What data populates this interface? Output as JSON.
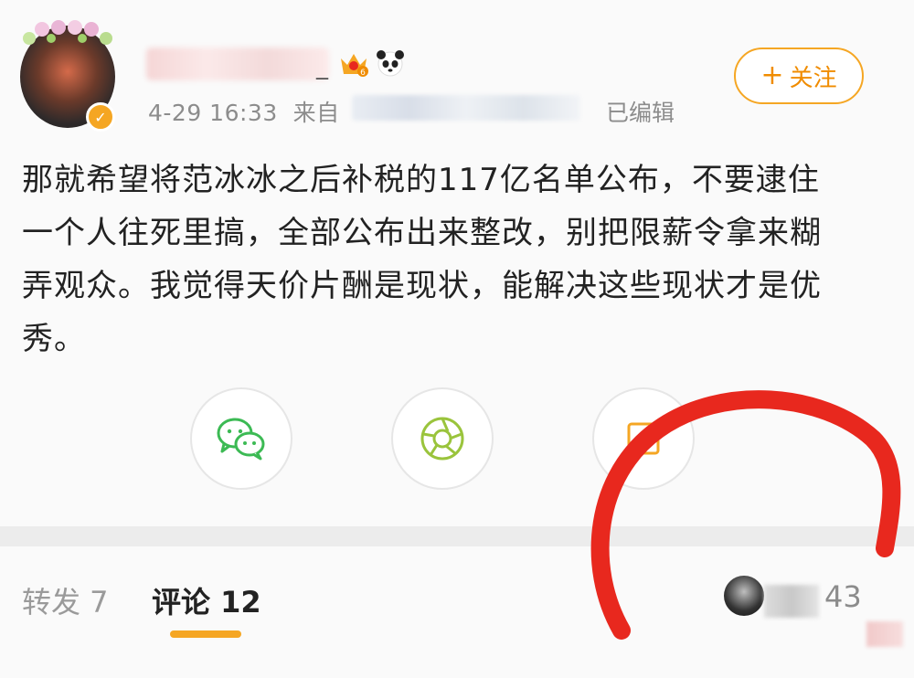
{
  "post": {
    "timestamp": "4-29 16:33",
    "source_prefix": "来自",
    "edited_label": "已编辑",
    "follow_label": "关注",
    "follow_plus": "+",
    "verified_mark": "✓",
    "name_suffix": "_",
    "level_badge": "6",
    "text": "那就希望将范冰冰之后补税的117亿名单公布，不要逮住一个人往死里搞，全部公布出来整改，别把限薪令拿来糊弄观众。我觉得天价片酬是现状，能解决这些现状才是优秀。"
  },
  "share": {
    "icons": [
      "wechat-icon",
      "moments-icon",
      "image-share-icon"
    ]
  },
  "tabs": {
    "repost": "转发 7",
    "comment": "评论 12"
  },
  "likes": {
    "count": "43"
  },
  "colors": {
    "accent": "#f5a623",
    "wechat_green": "#3cba54",
    "moments_green": "#9ac43c",
    "annotation_red": "#e8281e"
  }
}
